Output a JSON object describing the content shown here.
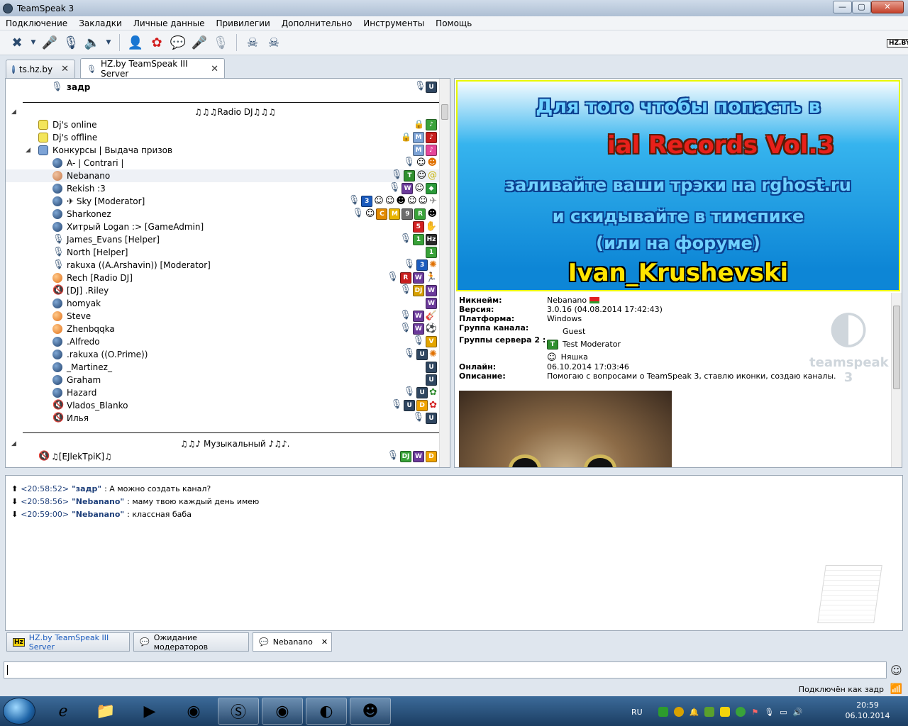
{
  "window": {
    "title": "TeamSpeak 3",
    "min": "—",
    "max": "▢",
    "close": "✕"
  },
  "menu": [
    "Подключение",
    "Закладки",
    "Личные данные",
    "Привилегии",
    "Дополнительно",
    "Инструменты",
    "Помощь"
  ],
  "toolbar_logo": "HZ.BY",
  "tabs": [
    {
      "label": "ts.hz.by",
      "close": "✕"
    },
    {
      "label": "HZ.by TeamSpeak III Server",
      "close": "✕"
    }
  ],
  "tree": {
    "top_client": "задр",
    "spacer_radio": "♫♫♫Radio DJ♫♫♫",
    "channels": [
      "Dj's online",
      "Dj's offline",
      "Конкурсы | Выдача призов"
    ],
    "clients": [
      "A- | Contrari |",
      "Nebanano",
      "Rekish :3",
      "✈ Sky [Moderator]",
      "Sharkonez",
      "Хитрый Logan :> [GameAdmin]",
      "James_Evans [Helper]",
      "North [Helper]",
      "rakuxa ((A.Arshavin)) [Moderator]",
      "Rech [Radio DJ]",
      "[DJ] .Riley",
      "homyak",
      "Steve",
      "Zhenbqqka",
      ".Alfredo",
      ".rakuxa ((O.Prime))",
      "_Martinez_",
      "Graham",
      "Hazard",
      "Vlados_Blanko",
      "Илья"
    ],
    "spacer_music": "♫♫♪ Музыкальный ♪♫♪.",
    "music_client": "♫[EJlekTpiK]♫"
  },
  "badges": {
    "u": "U",
    "t": "T",
    "w": "W",
    "three": "3",
    "c": "C",
    "m": "M",
    "nine": "9",
    "r": "R",
    "five": "5",
    "one": "1",
    "hz": "Hz",
    "dj": "DJ",
    "v": "V",
    "d": "D"
  },
  "colors": {
    "u": "#2f4660",
    "t": "#2f8f2f",
    "w": "#6b3a9a",
    "three": "#1b5bbd",
    "c": "#e28a00",
    "m": "#e8b400",
    "nine": "#6c6c6c",
    "r": "#c81e1e",
    "five": "#d22222",
    "one": "#39a239",
    "hz": "#2a2a2a",
    "dj": "#d8a100",
    "v": "#e4a500",
    "d": "#f0a400",
    "accent": "#1e3f7a"
  },
  "banner": {
    "line1": "Для того чтобы попасть в",
    "line2": "ial Records Vol.3",
    "line3": "заливайте ваши трэки на rghost.ru",
    "line4": "и скидывайте  в тимспике",
    "line5": "(или на форуме)",
    "line6": "Ivan_Krushevski"
  },
  "info": {
    "nick_k": "Никнейм:",
    "nick_v": "Nebanano",
    "ver_k": "Версия:",
    "ver_v": "3.0.16 (04.08.2014 17:42:43)",
    "plat_k": "Платформа:",
    "plat_v": "Windows",
    "chgroup_k": "Группа канала:",
    "chgroup_v": "Guest",
    "srvgroup_k": "Группы сервера 2 :",
    "srvgroup_v1": "Test Moderator",
    "srvgroup_v2": "Няшка",
    "online_k": "Онлайн:",
    "online_v": "06.10.2014 17:03:46",
    "desc_k": "Описание:",
    "desc_v": "Помогаю с вопросами о TeamSpeak 3, ставлю иконки, создаю каналы.",
    "watermark": "teamspeak 3"
  },
  "chat": [
    {
      "time": "<20:58:52>",
      "name": "\"задр\"",
      "text": ": А можно создать канал?"
    },
    {
      "time": "<20:58:56>",
      "name": "\"Nebanano\"",
      "text": ": маму твою каждый день имею"
    },
    {
      "time": "<20:59:00>",
      "name": "\"Nebanano\"",
      "text": ": классная баба"
    }
  ],
  "chat_tabs": [
    {
      "label": "HZ.by TeamSpeak III Server"
    },
    {
      "label": "Ожидание модераторов"
    },
    {
      "label": "Nebanano",
      "close": "✕"
    }
  ],
  "status": "Подключён как задр",
  "taskbar": {
    "lang": "RU",
    "time": "20:59",
    "date": "06.10.2014"
  }
}
